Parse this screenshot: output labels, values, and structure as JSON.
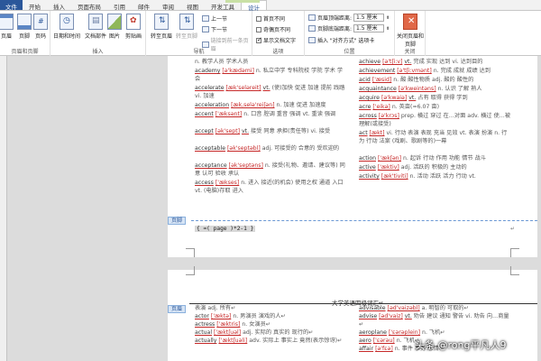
{
  "tabs": [
    {
      "label": "文件",
      "kind": "file"
    },
    {
      "label": "开始",
      "kind": "normal"
    },
    {
      "label": "插入",
      "kind": "normal"
    },
    {
      "label": "页面布局",
      "kind": "normal"
    },
    {
      "label": "引用",
      "kind": "normal"
    },
    {
      "label": "邮件",
      "kind": "normal"
    },
    {
      "label": "审阅",
      "kind": "normal"
    },
    {
      "label": "视图",
      "kind": "normal"
    },
    {
      "label": "开发工具",
      "kind": "normal"
    },
    {
      "label": "设计",
      "kind": "active"
    }
  ],
  "ribbon": {
    "hf_group": {
      "label": "页眉和页脚",
      "header": "页眉",
      "footer": "页脚",
      "page_number": "页码"
    },
    "insert_group": {
      "label": "插入",
      "date_time": "日期和时间",
      "doc_parts": "文档部件",
      "picture": "图片",
      "clip_art": "剪贴画"
    },
    "nav_group": {
      "label": "导航",
      "goto_header": "转至页眉",
      "goto_footer": "转至页脚",
      "previous": "上一节",
      "next": "下一节",
      "link_previous": "链接到前一条页眉"
    },
    "options_group": {
      "label": "选项",
      "first_page": "首页不同",
      "odd_even": "奇偶页不同",
      "show_text": "显示文档文字"
    },
    "position_group": {
      "label": "位置",
      "header_from_top": "页眉顶端距离:",
      "header_value": "1.5 厘米",
      "footer_from_bottom": "页脚底端距离:",
      "footer_value": "1.5 厘米",
      "align_tab": "插入 \"对齐方式\" 选项卡"
    },
    "close_group": {
      "label": "关闭",
      "close_btn": "关闭页眉和页脚"
    }
  },
  "page1": {
    "left": [
      {
        "hw": "",
        "ph": "",
        "def": "n. 教学人员 学术人员"
      },
      {
        "hw": "academy",
        "ph": "[ə'kædəmi]",
        "def": "n. 私立中学 专科院校 学院 学术 学会"
      },
      {
        "hw": "accelerate",
        "ph": "[æk'seləreit]",
        "ps": "vt.",
        "def": "(使)加快 促进 加速 提前 践踏 vi. 加速"
      },
      {
        "hw": "acceleration",
        "ph": "[æk,selə'reiʃən]",
        "def": "n. 加速 促进 加速度"
      },
      {
        "hw": "accent",
        "ph": "['æksənt]",
        "def": "n. 口音 腔调 重音 强调 vt. 重读 强调"
      },
      {
        "hw": "accept",
        "ph": "[ək'sept]",
        "ps": "vt.",
        "def": "接受 同意 承担(责任等) vi. 接受"
      },
      {
        "hw": "acceptable",
        "ph": "[ək'septəbl]",
        "def": "adj. 可接受的 合意的 受欢迎的"
      },
      {
        "hw": "acceptance",
        "ph": "[ək'septəns]",
        "def": "n. 接受(礼物、邀请、建议等) 同意 认可 验收 承认"
      },
      {
        "hw": "access",
        "ph": "['ækses]",
        "def": "n. 进入 接近(的机会) 使用之权 通道 入口 vt. (电脑)存取 进入"
      }
    ],
    "right": [
      {
        "hw": "achieve",
        "ph": "[ə'tʃi:v]",
        "ps": "vt.",
        "def": "完成 实现 达到 vi. 达到目的"
      },
      {
        "hw": "achievement",
        "ph": "[ə'tʃi:vmənt]",
        "def": "n. 完成 成就 成绩 达到"
      },
      {
        "hw": "acid",
        "ph": "['æsid]",
        "def": "n. 酸 酸性物质 adj. 酸的 酸性的"
      },
      {
        "hw": "acquaintance",
        "ph": "[ə'kweintəns]",
        "def": "n. 认识 了解 熟人"
      },
      {
        "hw": "acquire",
        "ph": "[ə'kwaiə]",
        "ps": "vt.",
        "def": "占有 取得 获得 学到"
      },
      {
        "hw": "acre",
        "ph": "['eikə]",
        "def": "n. 英亩(=6.07 亩)"
      },
      {
        "hw": "across",
        "ph": "[ə'krɔs]",
        "def": "prep. 横过 穿过 在…对面 adv. 横过 使…被理解(或接受)"
      },
      {
        "hw": "act",
        "ph": "[ækt]",
        "def": "vi. 行动 表演 表现 充当 见效 vt. 表演 扮演 n. 行为 行动 法案 (戏剧、歌剧等的)一幕"
      },
      {
        "hw": "action",
        "ph": "['ækʃən]",
        "def": "n. 起诉 行动 作用 功能 情节 战斗"
      },
      {
        "hw": "active",
        "ph": "['æktiv]",
        "def": "adj. 活跃的 积极的 主动的"
      },
      {
        "hw": "activity",
        "ph": "[æk'tiviti]",
        "def": "n. 活动 活跃 活力 行动 vt."
      }
    ],
    "footer_label": "页脚",
    "footer_field": "{ =( page )*2-1 }",
    "para_mark": "↵"
  },
  "page2": {
    "header_label": "页眉",
    "header_title": "大学英语四级词汇↵",
    "left": [
      {
        "hw": "",
        "ph": "",
        "def": "表演 adj. 所有↵"
      },
      {
        "hw": "actor",
        "ph": "['æktə]",
        "def": "n. 男演员 演戏的人↵"
      },
      {
        "hw": "actress",
        "ph": "['æktris]",
        "def": "n. 女演员↵"
      },
      {
        "hw": "actual",
        "ph": "['æktʃuəl]",
        "def": "adj. 实际的 真实的 现行的↵"
      },
      {
        "hw": "actually",
        "ph": "['æktʃuəli]",
        "def": "adv. 实际上 事实上 竟然(表示惊讶)↵"
      }
    ],
    "right": [
      {
        "hw": "advisable",
        "ph": "[əd'vaizəbl]",
        "def": "a. 明智的 可取的↵"
      },
      {
        "hw": "advise",
        "ph": "[əd'vaiz]",
        "ps": "vt.",
        "def": "劝告 建议 通知 警告 vi. 劝告 向…商量↵"
      },
      {
        "hw": "aeroplane",
        "ph": "['ɛərəplein]",
        "def": "n. 飞机↵"
      },
      {
        "hw": "aero",
        "ph": "['ɛərəu]",
        "def": "n. 飞机↵"
      },
      {
        "hw": "affair",
        "ph": "[ə'fɛə]",
        "def": "n. 事件 事务 恋情↵"
      }
    ]
  },
  "watermark": "头条 @rong平凡人9"
}
